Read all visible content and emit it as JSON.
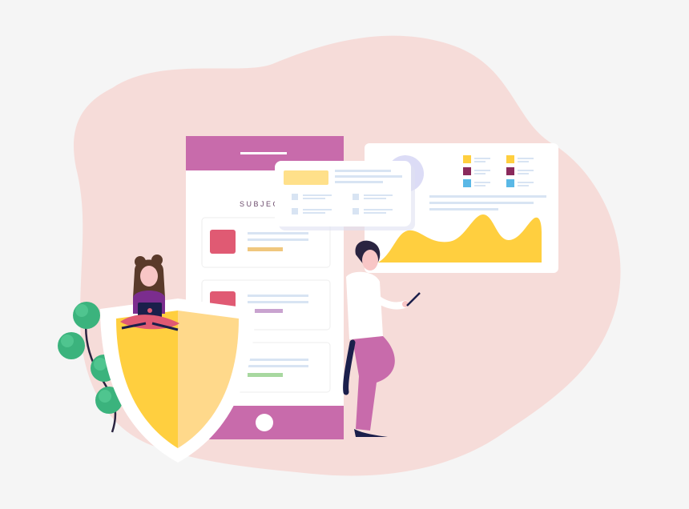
{
  "phone_card": {
    "tag_label": "SUBJECT"
  },
  "colors": {
    "background": "#f5f5f5",
    "blob": "#f6dcd9",
    "phone_header": "#c86bab",
    "accent_yellow": "#ffcf3f",
    "accent_pink": "#e05a73",
    "accent_purple": "#8a2a5c",
    "accent_blue": "#5ab8e6",
    "shield_dark": "#ffcf3f",
    "shield_light": "#ffd98b",
    "leaf_green": "#3bb37d",
    "skin_purple": "#7b2d8e",
    "pants_pink": "#c86bab"
  },
  "icons": {
    "shield": "shield-icon",
    "plant": "plant-icon",
    "chart": "area-chart-icon"
  }
}
